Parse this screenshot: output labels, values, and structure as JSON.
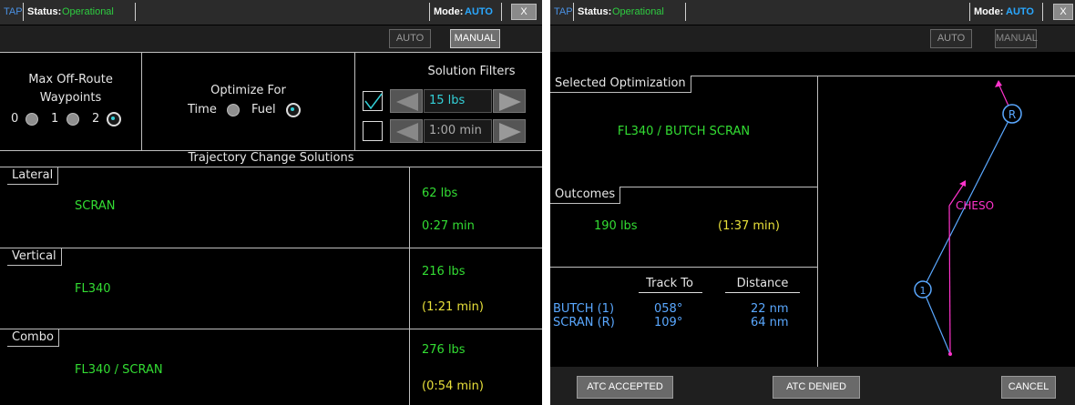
{
  "left": {
    "titlebar": {
      "app": "TAP",
      "status_label": "Status:",
      "status_value": "Operational",
      "mode_label": "Mode:",
      "mode_value": "AUTO",
      "close": "X"
    },
    "toolbar": {
      "auto": "AUTO",
      "manual": "MANUAL"
    },
    "waypoints": {
      "title_line1": "Max Off-Route",
      "title_line2": "Waypoints",
      "opt0": "0",
      "opt1": "1",
      "opt2": "2",
      "selected": "2"
    },
    "optimize": {
      "title": "Optimize For",
      "time": "Time",
      "fuel": "Fuel",
      "selected": "Fuel"
    },
    "filters": {
      "title": "Solution Filters",
      "fuel_value": "15 lbs",
      "fuel_checked": true,
      "time_value": "1:00 min",
      "time_checked": false
    },
    "solutions_header": "Trajectory Change Solutions",
    "solutions": [
      {
        "tab": "Lateral",
        "route": "SCRAN",
        "fuel": "62 lbs",
        "time": "0:27 min"
      },
      {
        "tab": "Vertical",
        "route": "FL340",
        "fuel": "216 lbs",
        "time": "(1:21 min)"
      },
      {
        "tab": "Combo",
        "route": "FL340 / SCRAN",
        "fuel": "276 lbs",
        "time": "(0:54 min)"
      }
    ]
  },
  "right": {
    "titlebar": {
      "app": "TAP",
      "status_label": "Status:",
      "status_value": "Operational",
      "mode_label": "Mode:",
      "mode_value": "AUTO",
      "close": "X"
    },
    "toolbar": {
      "auto": "AUTO",
      "manual": "MANUAL"
    },
    "selected_tab": "Selected Optimization",
    "selected_value": "FL340 / BUTCH SCRAN",
    "outcomes_tab": "Outcomes",
    "outcomes_fuel": "190 lbs",
    "outcomes_time": "(1:37 min)",
    "table": {
      "headers": [
        "Track To",
        "Distance"
      ],
      "rows": [
        {
          "wp": "BUTCH (1)",
          "track": "058°",
          "dist": "22 nm"
        },
        {
          "wp": "SCRAN (R)",
          "track": "109°",
          "dist": "64 nm"
        }
      ]
    },
    "map": {
      "wp1": "1",
      "wpR": "R",
      "cheso": "CHESO"
    },
    "buttons": {
      "accepted": "ATC ACCEPTED",
      "denied": "ATC DENIED",
      "cancel": "CANCEL"
    },
    "colors": {
      "route": "#5aa8ff",
      "alt_route": "#ff33cc",
      "green": "#33dd33",
      "yellow": "#e8e03a"
    }
  }
}
